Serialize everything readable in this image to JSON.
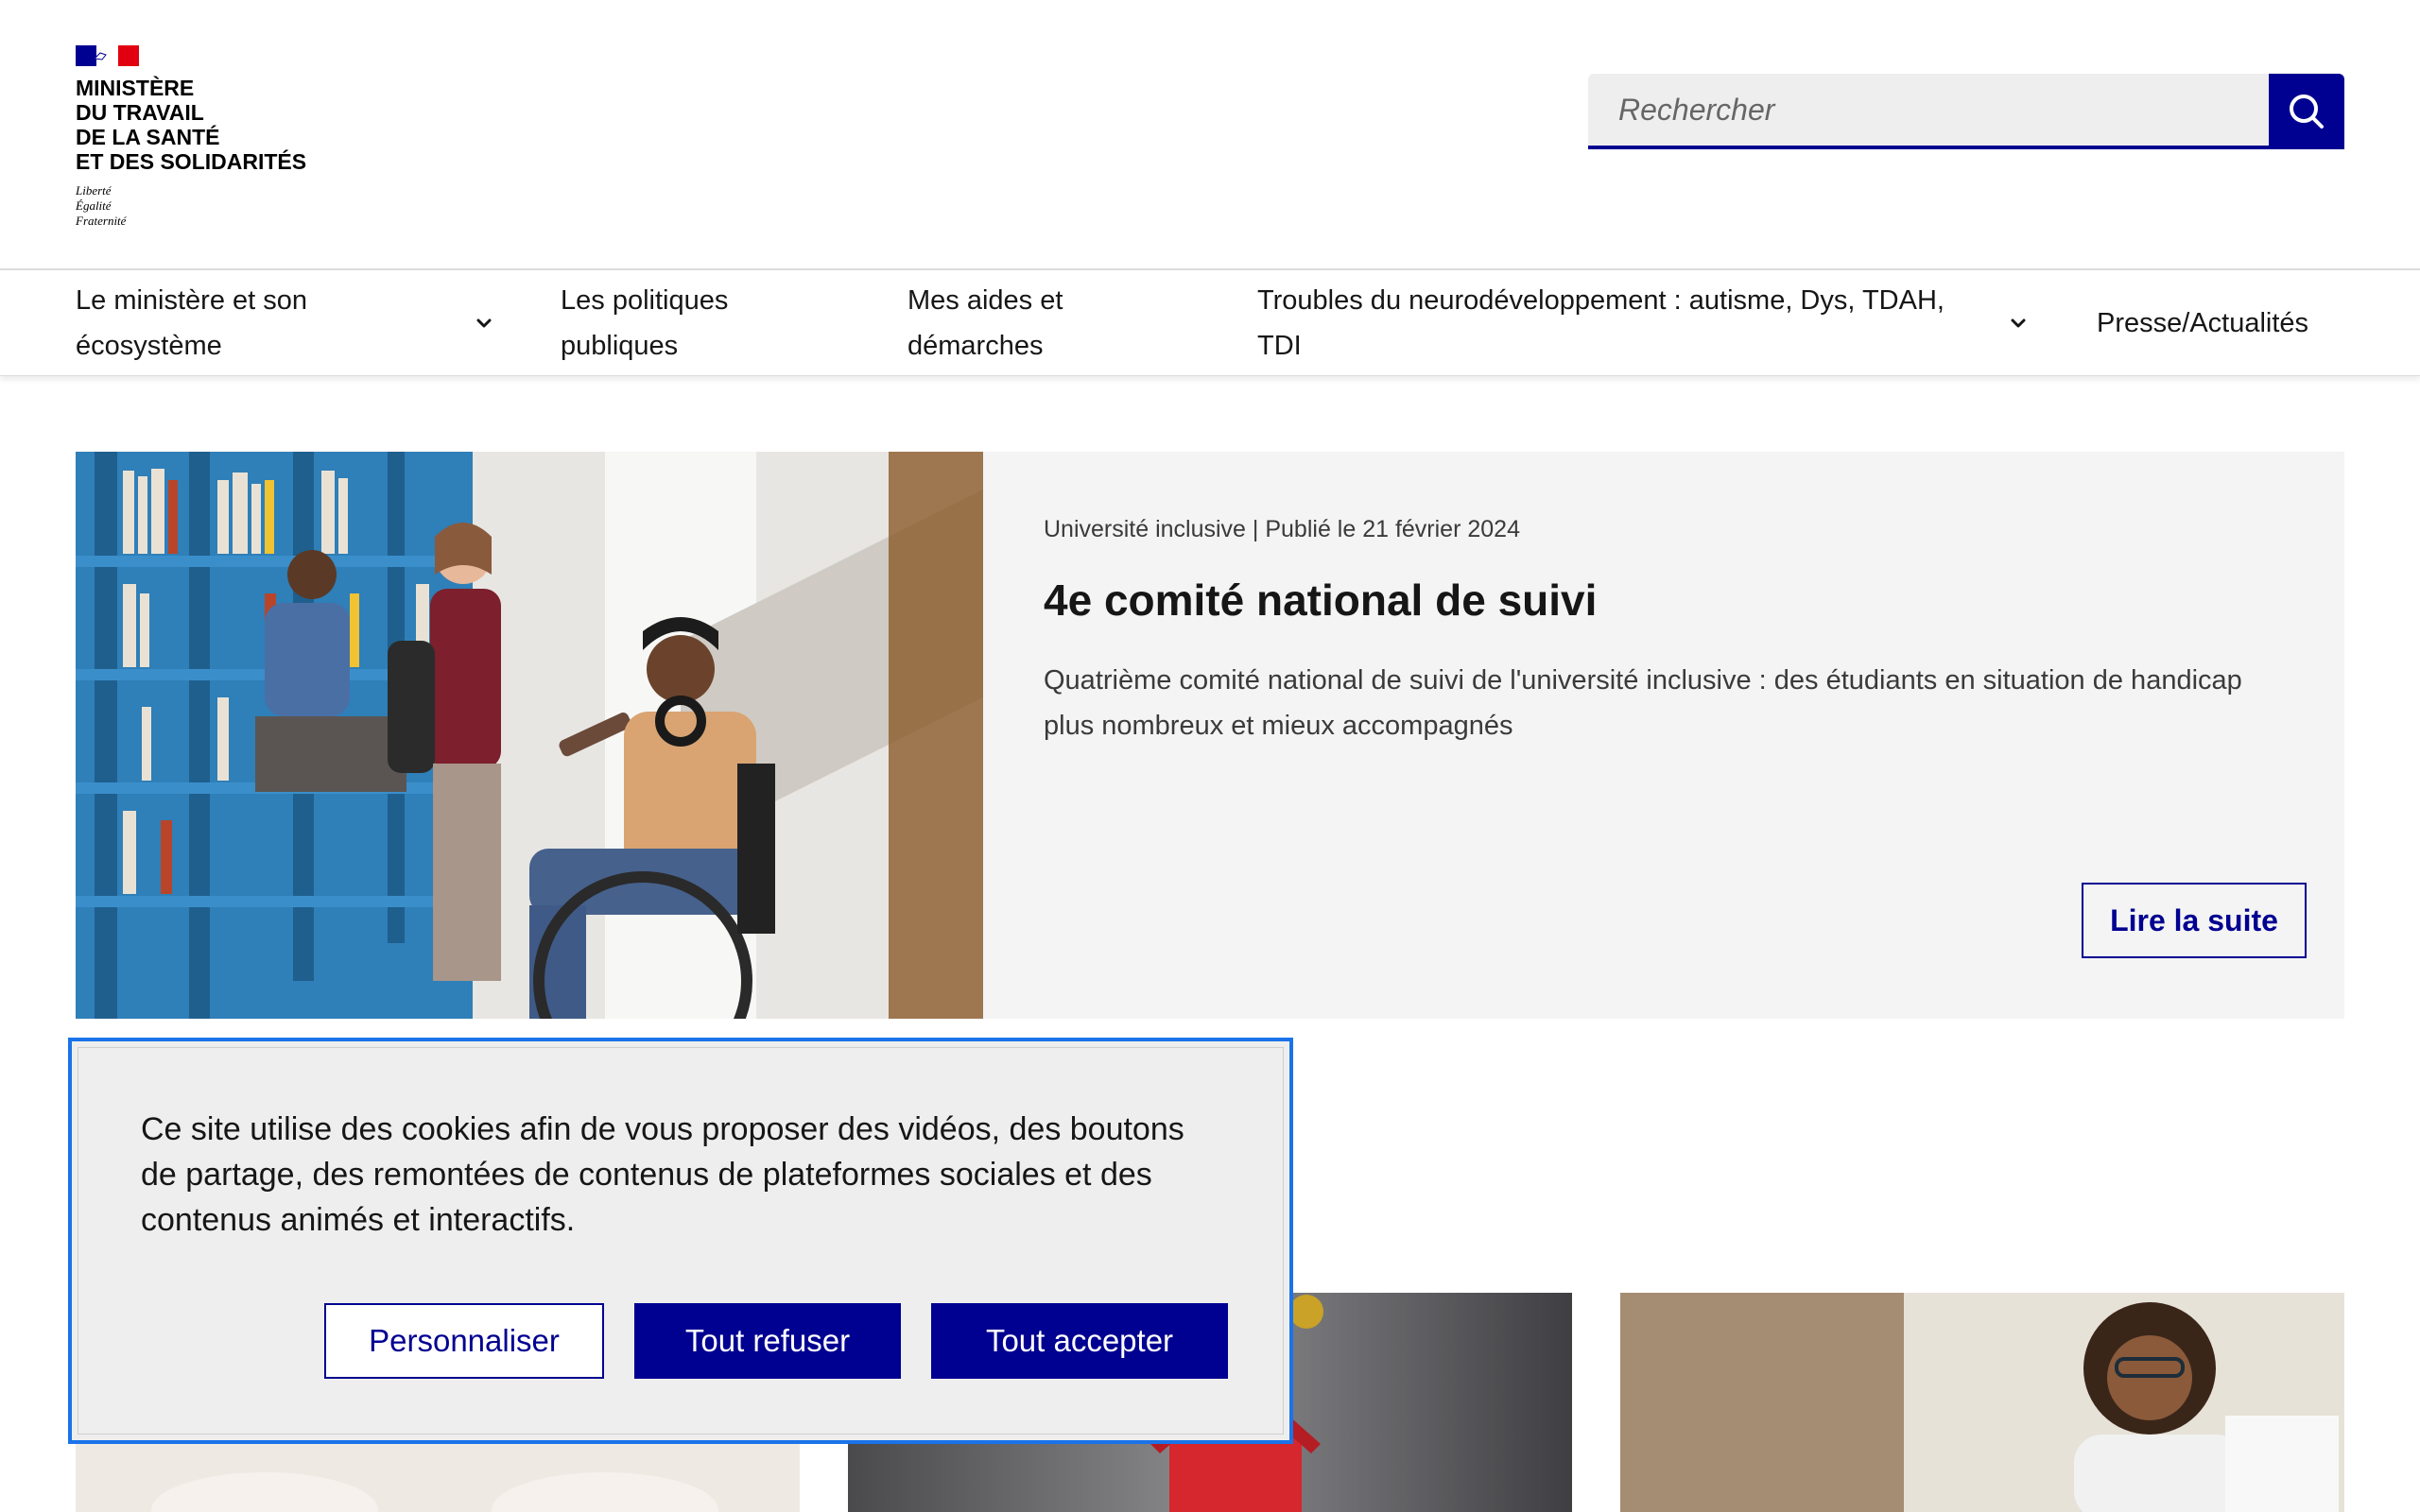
{
  "colors": {
    "primary": "#000091",
    "flag_blue": "#000091",
    "flag_white": "#ffffff",
    "flag_red": "#e1000f",
    "hero_bg": "#f4f4f4",
    "focus_outline": "#1a73e8"
  },
  "header": {
    "logo": {
      "title_lines": [
        "MINISTÈRE",
        "DU TRAVAIL",
        "DE LA SANTÉ",
        "ET DES SOLIDARITÉS"
      ],
      "motto_lines": [
        "Liberté",
        "Égalité",
        "Fraternité"
      ]
    },
    "search": {
      "placeholder": "Rechercher",
      "button_icon": "search-icon"
    }
  },
  "nav": {
    "items": [
      {
        "label_lines": [
          "Le ministère et son",
          "écosystème"
        ],
        "has_dropdown": true
      },
      {
        "label_lines": [
          "Les politiques",
          "publiques"
        ],
        "has_dropdown": false
      },
      {
        "label_lines": [
          "Mes aides et",
          "démarches"
        ],
        "has_dropdown": false
      },
      {
        "label_lines": [
          "Troubles du neurodéveloppement : autisme, Dys, TDAH,",
          "TDI"
        ],
        "has_dropdown": true
      },
      {
        "label_lines": [
          "Presse/Actualités"
        ],
        "has_dropdown": false
      }
    ]
  },
  "hero": {
    "meta": "Université inclusive | Publié le 21 février 2024",
    "title": "4e comité national de suivi",
    "description": "Quatrième comité national de suivi de l'université inclusive : des étudiants en situation de handicap plus nombreux et mieux accompagnés",
    "link_label": "Lire la suite"
  },
  "cookie_banner": {
    "text": "Ce site utilise des cookies afin de vous proposer des vidéos, des boutons de partage, des remontées de contenus de plateformes sociales et des contenus animés et interactifs.",
    "buttons": {
      "customize": "Personnaliser",
      "refuse_all": "Tout refuser",
      "accept_all": "Tout accepter"
    }
  }
}
